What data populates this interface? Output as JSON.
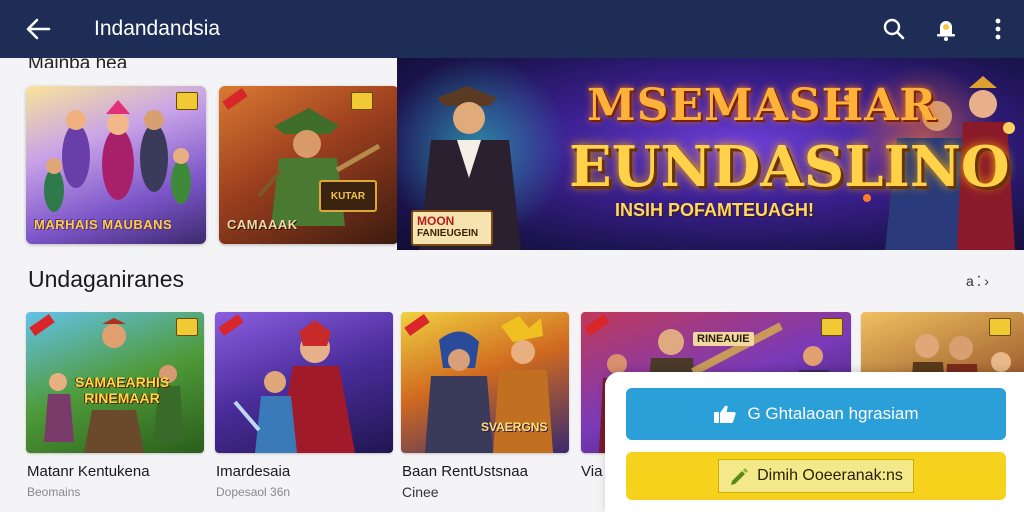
{
  "appbar": {
    "title": "Indandandsia",
    "icons": [
      "back-arrow-icon",
      "search-icon",
      "notification-icon",
      "more-vert-icon"
    ]
  },
  "featured": {
    "partial_heading": "Mainba hea",
    "cards": [
      {
        "caption": "MARHAIS MAUBANS"
      },
      {
        "caption": "CAMAAAK",
        "plaque": "KUTAR"
      }
    ],
    "hero": {
      "title_line1": "MSEMASHAR",
      "title_line2": "EUNDASLINO",
      "subtitle": "INSIH POFAMTEUAGH!",
      "sign_line1": "MOON",
      "sign_line2": "FANIEUGEIN"
    }
  },
  "section": {
    "title": "Undaganiranes",
    "more_label": "a",
    "games": [
      {
        "caption": "SAMAEARHIS RINEMAAR",
        "title": "Matanr Kentukena",
        "subtitle": "Beomains"
      },
      {
        "caption": "",
        "title": "Imardesaia",
        "subtitle": "Dopesaol 36n"
      },
      {
        "caption": "SVAERGNS",
        "title": "Baan RentUstsnaa",
        "subtitle": "Cinee"
      },
      {
        "caption": "RINEAUIE",
        "title": "Via",
        "subtitle": ""
      },
      {
        "caption": "",
        "title": "",
        "subtitle": ""
      }
    ]
  },
  "actions": {
    "primary_label": "G Ghtalaoan hgrasiam",
    "secondary_label": "Dimih Ooeeranak:ns"
  },
  "colors": {
    "appbar": "#1d2d55",
    "primary_button": "#2a9fd8",
    "secondary_button": "#f6d21c"
  }
}
